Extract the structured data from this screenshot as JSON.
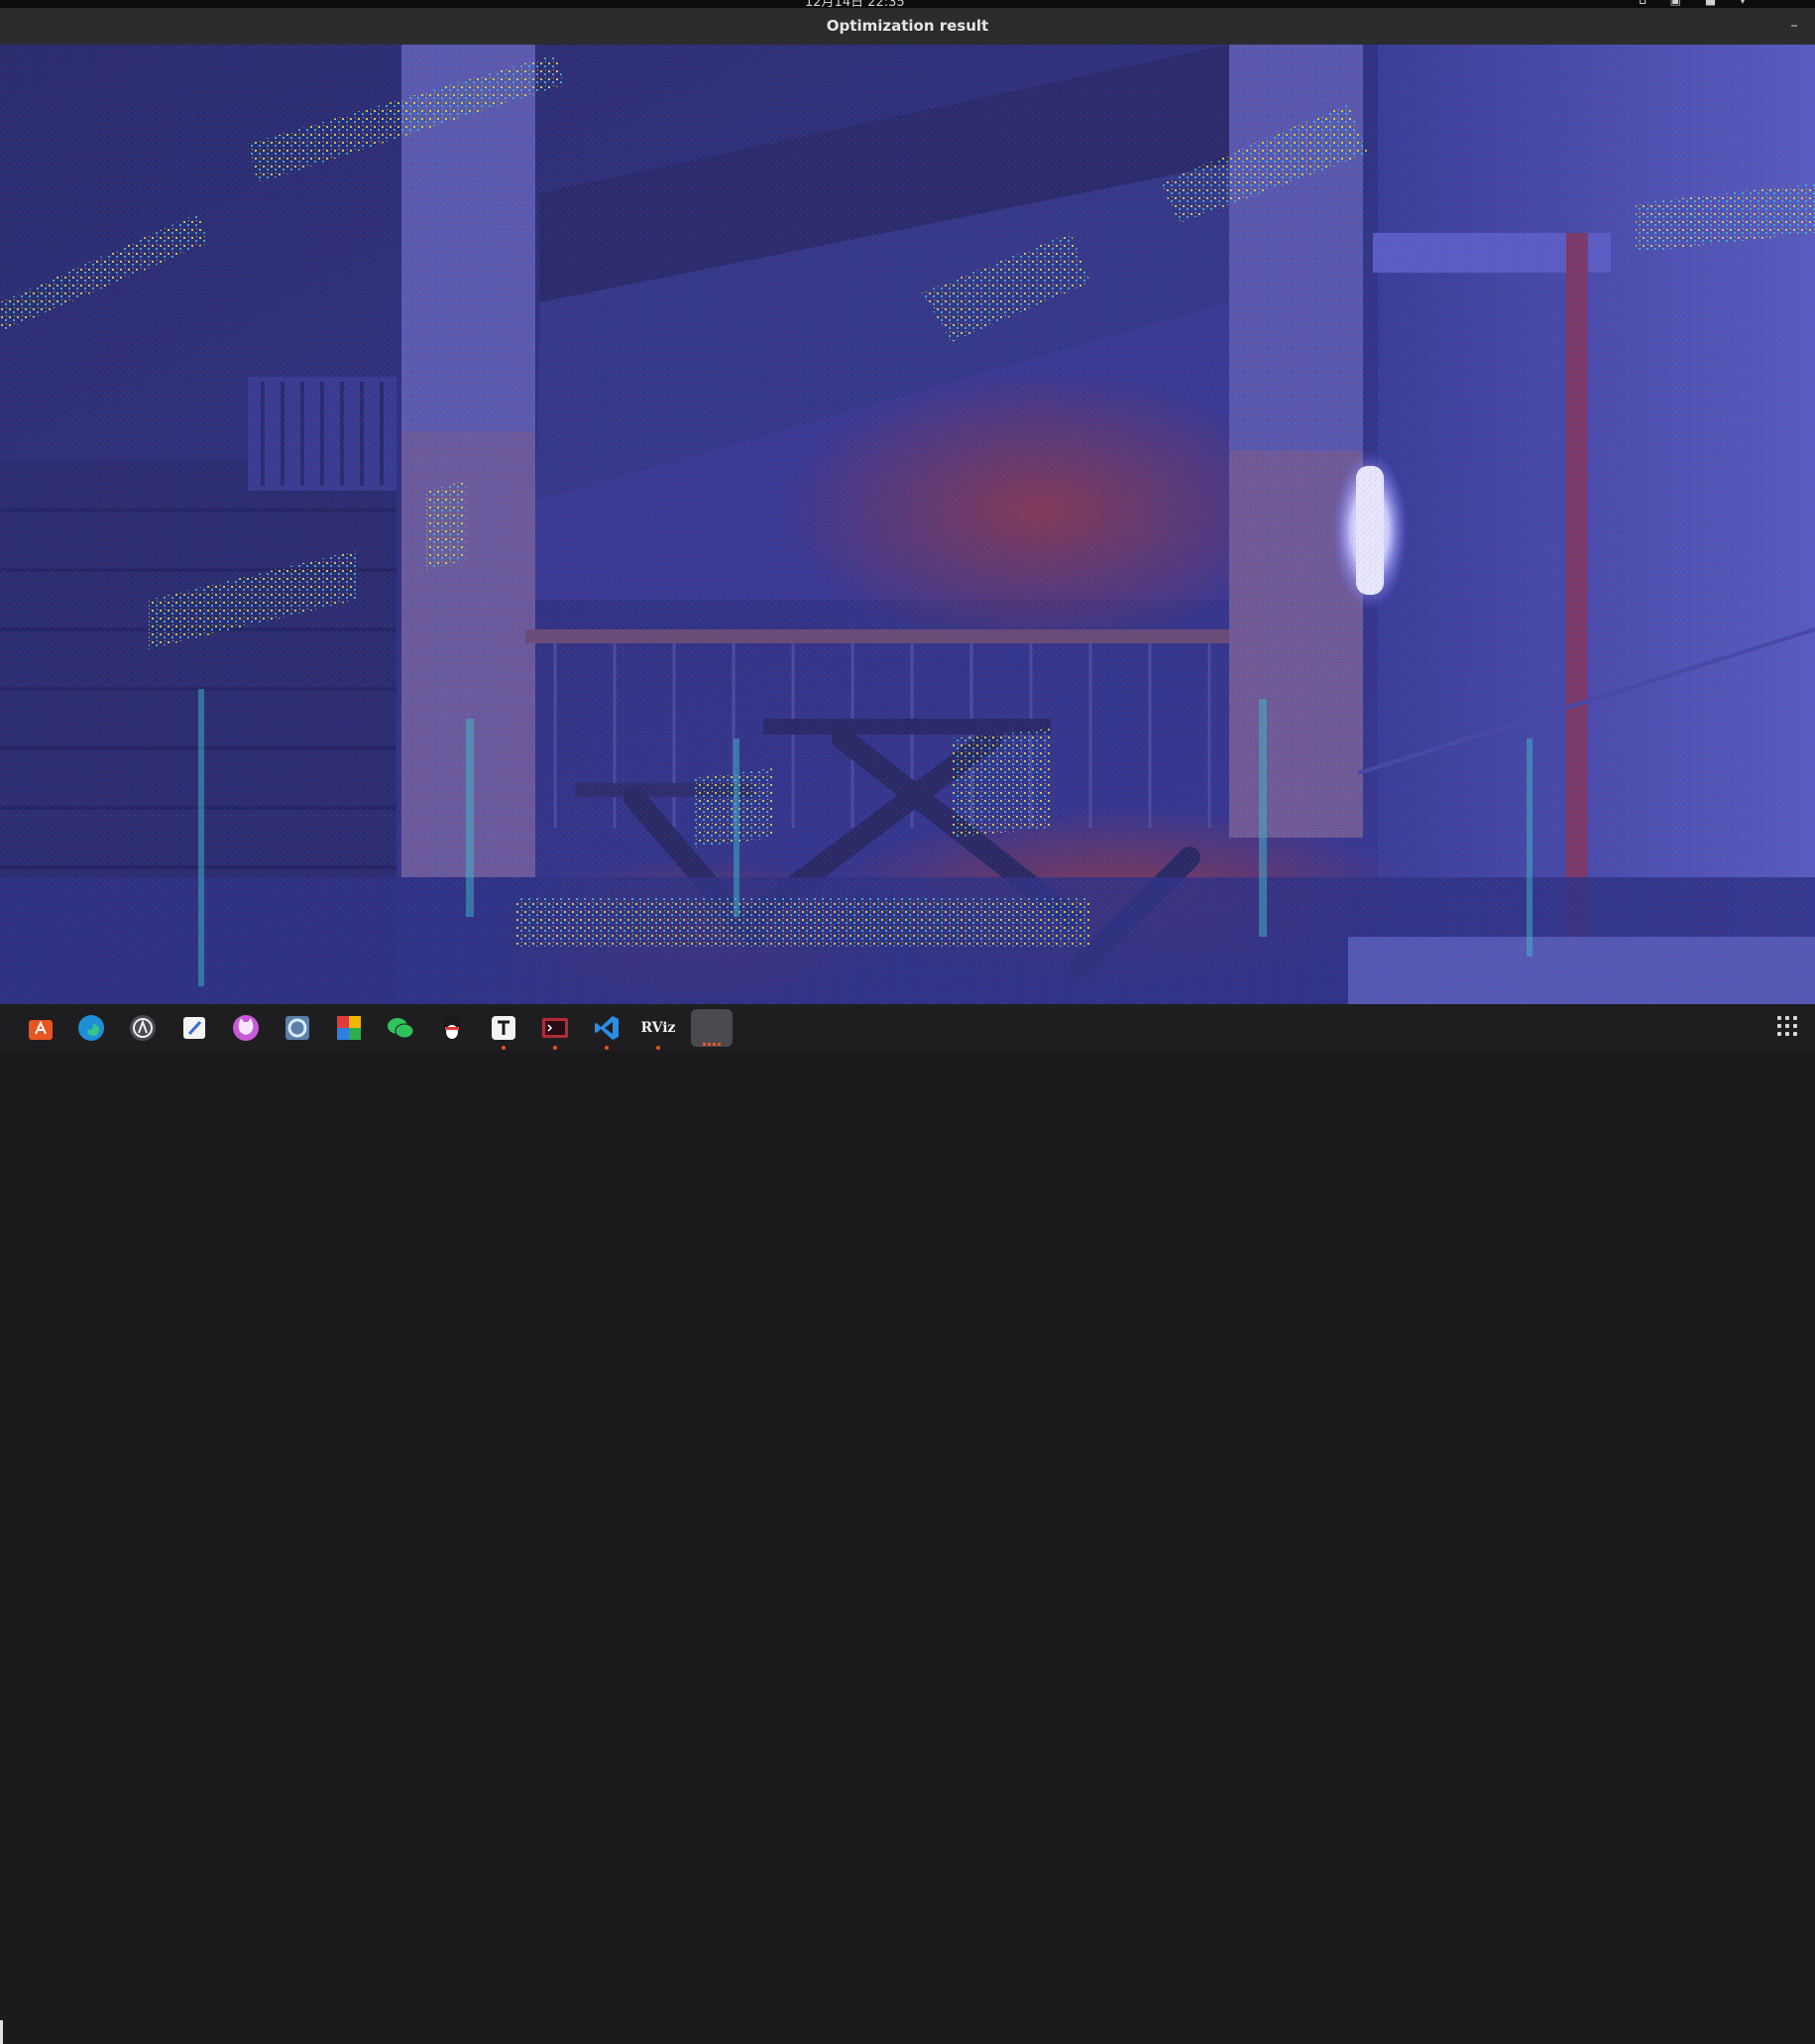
{
  "window": {
    "title": "Optimization result"
  },
  "topbar": {
    "clock": "12月14日 22:35"
  },
  "colors": {
    "titlebar": "#2c2c2e",
    "dock": "#1e1e20",
    "image_base": "#2e2f82",
    "warm_tone": "#9b3b3b",
    "point_yellow": "#d8d64a",
    "point_cyan": "#3fb7c9"
  },
  "dock": {
    "items": [
      {
        "name": "software-center-icon"
      },
      {
        "name": "edge-browser-icon"
      },
      {
        "name": "arduino-icon"
      },
      {
        "name": "text-editor-icon"
      },
      {
        "name": "cat-app-icon"
      },
      {
        "name": "calculator-icon"
      },
      {
        "name": "wps-office-icon"
      },
      {
        "name": "wechat-icon"
      },
      {
        "name": "qq-icon"
      },
      {
        "name": "typora-icon"
      },
      {
        "name": "terminal-icon"
      },
      {
        "name": "vscode-icon"
      },
      {
        "name": "rviz-icon",
        "label": "RViz"
      },
      {
        "name": "active-window-icon"
      }
    ]
  }
}
